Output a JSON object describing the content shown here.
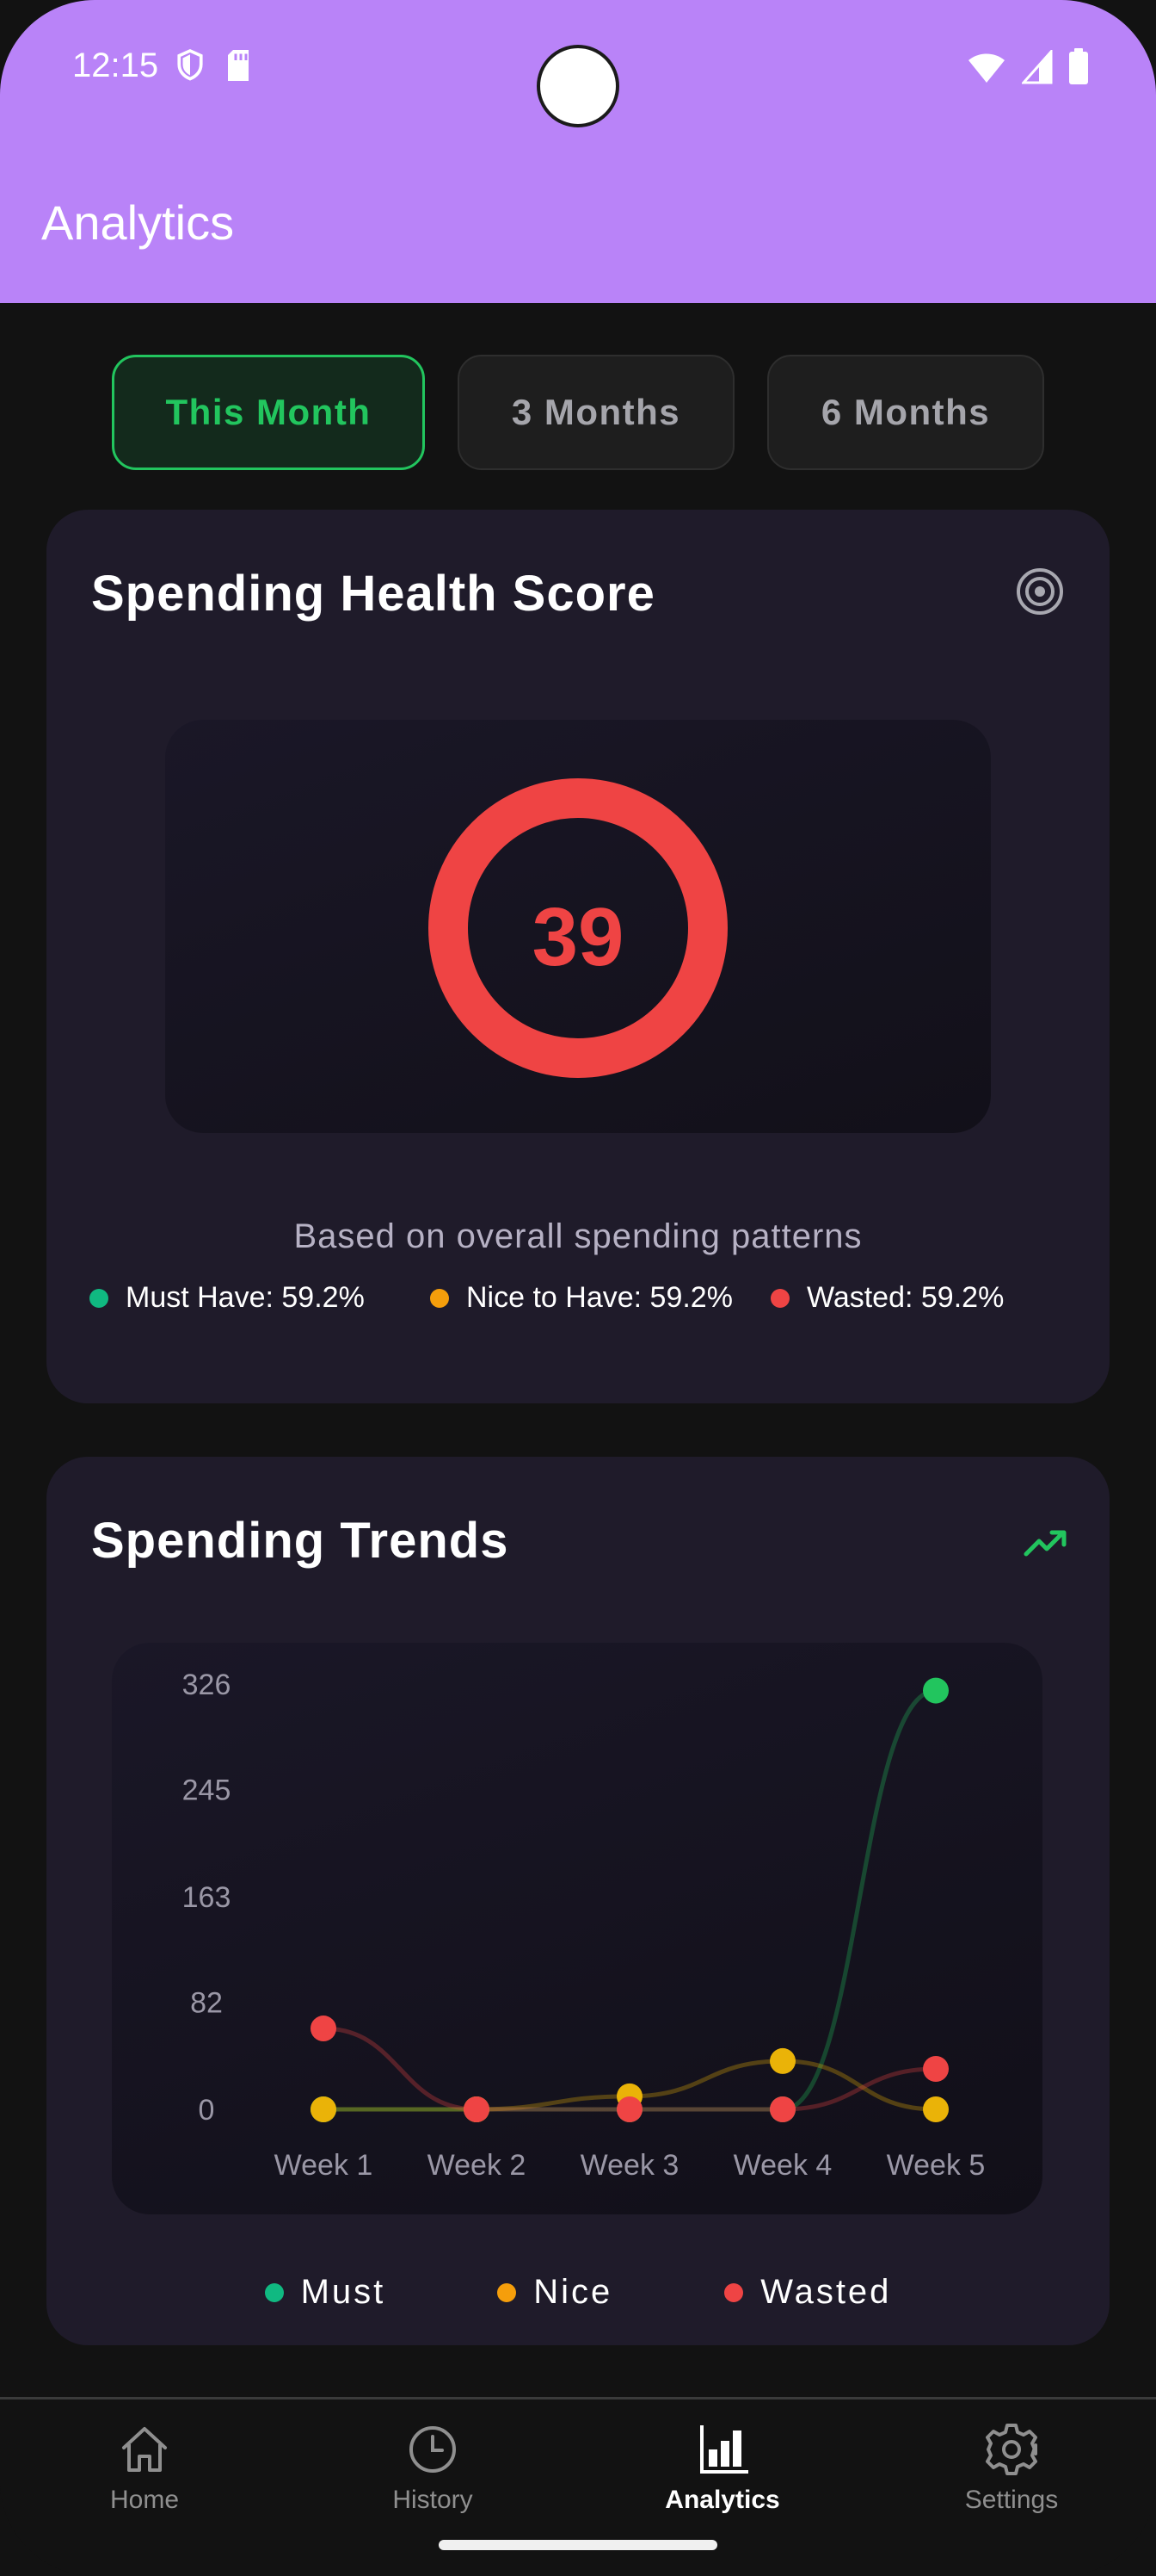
{
  "status_bar": {
    "time": "12:15"
  },
  "app_bar": {
    "title": "Analytics"
  },
  "range_tabs": [
    {
      "label": "This Month",
      "selected": true
    },
    {
      "label": "3 Months",
      "selected": false
    },
    {
      "label": "6 Months",
      "selected": false
    }
  ],
  "health_card": {
    "title": "Spending Health Score",
    "score": "39",
    "score_color": "#ef4444",
    "subtitle": "Based on overall spending patterns",
    "legend": [
      {
        "label": "Must Have: 59.2%",
        "color": "#10b981"
      },
      {
        "label": "Nice to Have: 59.2%",
        "color": "#f59e0b"
      },
      {
        "label": "Wasted: 59.2%",
        "color": "#ef4444"
      }
    ]
  },
  "trends_card": {
    "title": "Spending Trends",
    "legend": [
      {
        "label": "Must",
        "color": "#10b981"
      },
      {
        "label": "Nice",
        "color": "#f59e0b"
      },
      {
        "label": "Wasted",
        "color": "#ef4444"
      }
    ]
  },
  "chart_data": {
    "type": "line",
    "title": "",
    "xlabel": "",
    "ylabel": "",
    "categories": [
      "Week 1",
      "Week 2",
      "Week 3",
      "Week 4",
      "Week 5"
    ],
    "y_ticks": [
      "0",
      "82",
      "163",
      "245",
      "326"
    ],
    "ylim": [
      0,
      326
    ],
    "grid": false,
    "legend_position": "bottom",
    "series": [
      {
        "name": "Must",
        "color": "#22c55e",
        "values": [
          0,
          0,
          0,
          0,
          321
        ]
      },
      {
        "name": "Nice",
        "color": "#eab308",
        "values": [
          0,
          0,
          10,
          37,
          0
        ]
      },
      {
        "name": "Wasted",
        "color": "#ef4444",
        "values": [
          62,
          0,
          0,
          0,
          31
        ]
      }
    ]
  },
  "bottom_nav": [
    {
      "label": "Home",
      "icon": "home-icon",
      "active": false
    },
    {
      "label": "History",
      "icon": "history-icon",
      "active": false
    },
    {
      "label": "Analytics",
      "icon": "analytics-icon",
      "active": true
    },
    {
      "label": "Settings",
      "icon": "settings-icon",
      "active": false
    }
  ]
}
